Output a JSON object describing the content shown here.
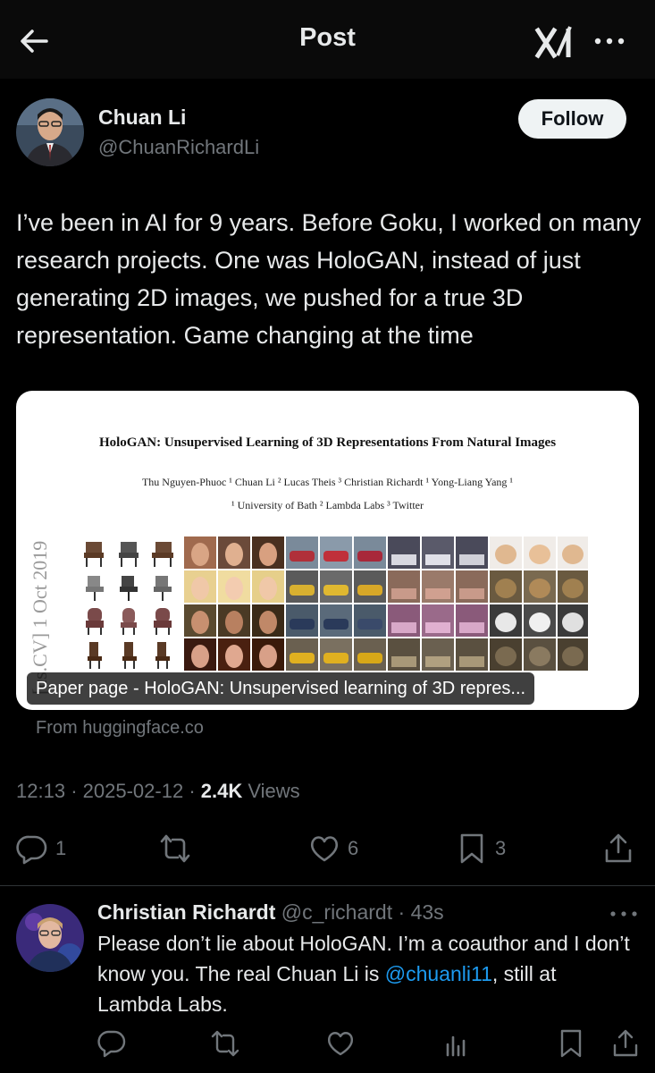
{
  "header": {
    "title": "Post"
  },
  "post": {
    "author_name": "Chuan Li",
    "author_handle": "@ChuanRichardLi",
    "follow_label": "Follow",
    "text": "I’ve been in AI for 9 years. Before Goku, I worked on many research projects. One was HoloGAN, instead of just generating 2D images, we pushed for a true 3D representation. Game changing at the time",
    "link_card": {
      "paper_title": "HoloGAN: Unsupervised Learning of 3D Representations From Natural Images",
      "paper_authors": "Thu Nguyen-Phuoc ¹   Chuan Li ²   Lucas Theis ³   Christian Richardt ¹   Yong-Liang Yang ¹",
      "paper_affiliations": "¹ University of Bath   ² Lambda Labs   ³ Twitter",
      "arxiv_stamp": "[cs.CV]  1 Oct 2019",
      "caption": "Paper page - HoloGAN: Unsupervised learning of 3D repres...",
      "source": "From huggingface.co"
    },
    "time": "12:13",
    "date": "2025-02-12",
    "views_count": "2.4K",
    "views_label": "Views",
    "actions": {
      "replies": "1",
      "retweets": "",
      "likes": "6",
      "bookmarks": "3"
    }
  },
  "reply": {
    "author_name": "Christian Richardt",
    "author_handle": "@c_richardt",
    "age": "43s",
    "text_before": "Please don’t lie about HoloGAN. I’m a coauthor and I don’t know you. The real Chuan Li is ",
    "mention": "@chuanli11",
    "text_after": ", still at Lambda Labs."
  },
  "colors": {
    "background": "#000000",
    "text_primary": "#e7e9ea",
    "text_secondary": "#71767b",
    "link": "#1d9bf0",
    "divider": "#2f3336"
  },
  "icons": [
    "back-arrow-icon",
    "grok-logo-icon",
    "more-icon",
    "reply-icon",
    "retweet-icon",
    "like-icon",
    "bookmark-icon",
    "share-icon",
    "views-icon"
  ]
}
